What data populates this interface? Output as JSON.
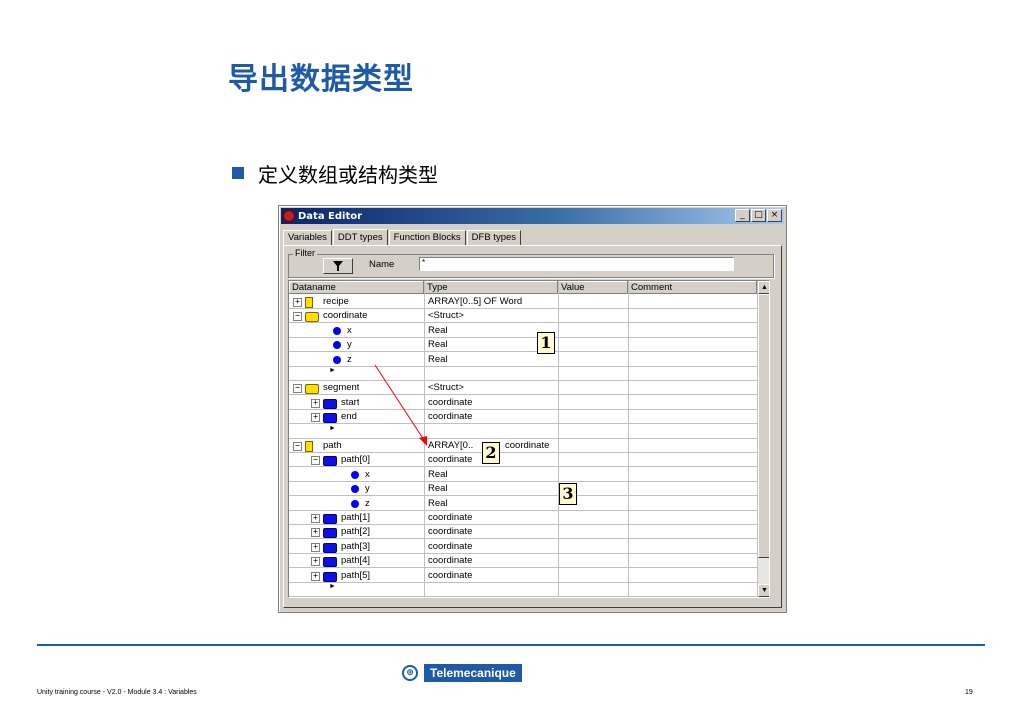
{
  "slide": {
    "title": "导出数据类型",
    "bullet": "定义数组或结构类型",
    "footer_left": "Unity training course - V2.0 - Module 3.4 : Variables",
    "footer_right": "19",
    "logo_text": "Telemecanique",
    "accent_color": "#1f5aa6"
  },
  "window": {
    "title": "Data Editor",
    "buttons": {
      "minimize": "_",
      "maximize": "□",
      "close": "×"
    },
    "tabs": [
      "Variables",
      "DDT types",
      "Function Blocks",
      "DFB types"
    ],
    "active_tab": "DDT types",
    "filter": {
      "label": "Filter",
      "name_label": "Name",
      "name_value": "*"
    },
    "columns": [
      "Dataname",
      "Type",
      "Value",
      "Comment"
    ],
    "rows": [
      {
        "name": "recipe",
        "type": "ARRAY[0..5] OF Word",
        "icon": "folder-single-icon",
        "expander": "+"
      },
      {
        "name": "coordinate",
        "type": "<Struct>",
        "icon": "folder-struct-icon",
        "expander": "−"
      },
      {
        "name": "x",
        "type": "Real",
        "icon": "dot-icon"
      },
      {
        "name": "y",
        "type": "Real",
        "icon": "dot-icon"
      },
      {
        "name": "z",
        "type": "Real",
        "icon": "dot-icon"
      },
      {
        "name": "",
        "type": "",
        "icon": "arrow-icon"
      },
      {
        "name": "segment",
        "type": "<Struct>",
        "icon": "folder-struct-icon",
        "expander": "−"
      },
      {
        "name": "start",
        "type": "coordinate",
        "icon": "folder-blue-icon",
        "expander": "+"
      },
      {
        "name": "end",
        "type": "coordinate",
        "icon": "folder-blue-icon",
        "expander": "+"
      },
      {
        "name": "",
        "type": "",
        "icon": "arrow-icon"
      },
      {
        "name": "path",
        "type": "ARRAY[0..",
        "type_tail": "coordinate",
        "icon": "folder-single-icon",
        "expander": "−"
      },
      {
        "name": "path[0]",
        "type": "coordinate",
        "icon": "folder-blue-icon",
        "expander": "−"
      },
      {
        "name": "x",
        "type": "Real",
        "icon": "dot-icon"
      },
      {
        "name": "y",
        "type": "Real",
        "icon": "dot-icon"
      },
      {
        "name": "z",
        "type": "Real",
        "icon": "dot-icon"
      },
      {
        "name": "path[1]",
        "type": "coordinate",
        "icon": "folder-blue-icon",
        "expander": "+"
      },
      {
        "name": "path[2]",
        "type": "coordinate",
        "icon": "folder-blue-icon",
        "expander": "+"
      },
      {
        "name": "path[3]",
        "type": "coordinate",
        "icon": "folder-blue-icon",
        "expander": "+"
      },
      {
        "name": "path[4]",
        "type": "coordinate",
        "icon": "folder-blue-icon",
        "expander": "+"
      },
      {
        "name": "path[5]",
        "type": "coordinate",
        "icon": "folder-blue-icon",
        "expander": "+"
      },
      {
        "name": "",
        "type": "",
        "icon": "arrow-icon"
      }
    ]
  },
  "callouts": [
    "1",
    "2",
    "3"
  ]
}
